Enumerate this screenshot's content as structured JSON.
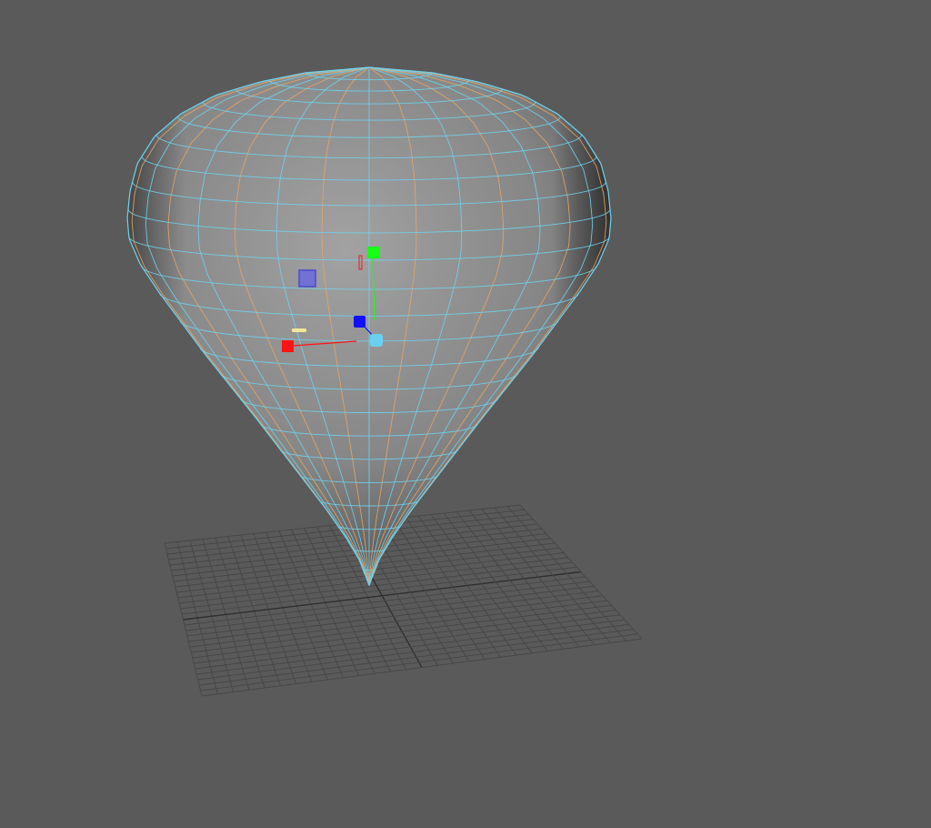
{
  "viewport": {
    "name": "3d-perspective-viewport",
    "background": "#5a5a5a"
  },
  "colors": {
    "wire_wire": "#6fd3ee",
    "wire_edge_loop": "#e7a565",
    "surface_light": "#9a9a9a",
    "surface_mid": "#7a7a7a",
    "surface_dark": "#2e2e2e",
    "grid_line": "#464646",
    "grid_axis": "#2f2f2f",
    "manip_x": "#ff1414",
    "manip_y": "#14ff14",
    "manip_z": "#1010ff",
    "manip_center": "#6ad0f0",
    "manip_plane": "#6a6ae0",
    "manip_highlight": "#f3e69a"
  },
  "icons": {
    "manipulator": "move-tool-manipulator-icon",
    "ground": "ground-grid-icon"
  }
}
